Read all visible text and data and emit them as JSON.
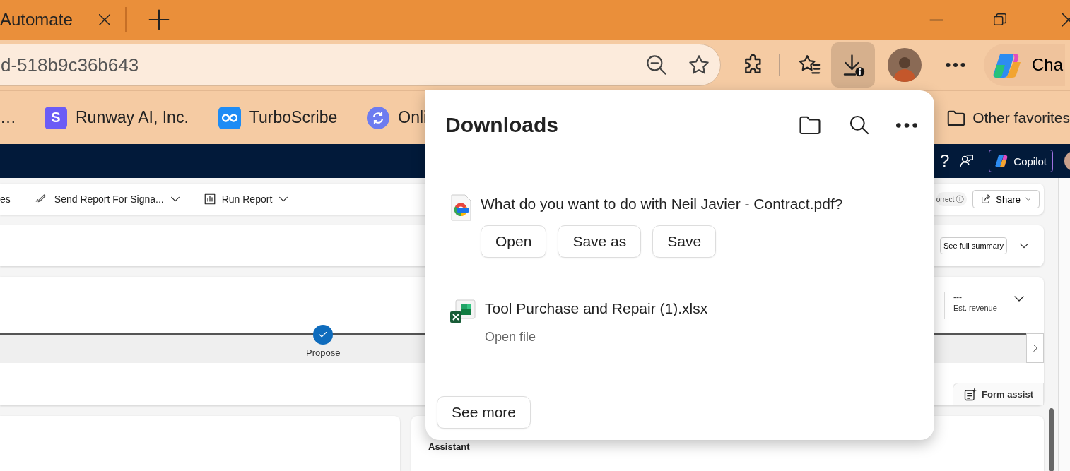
{
  "tab": {
    "title": "Automate"
  },
  "address_bar": {
    "url": "d-518b9c36b643"
  },
  "copilot_button": {
    "label": "Cha"
  },
  "favorites": [
    {
      "label": "…"
    },
    {
      "label": "Runway AI, Inc.",
      "icon_text": "S"
    },
    {
      "label": "TurboScribe"
    },
    {
      "label": "Onli"
    }
  ],
  "other_favorites": {
    "label": "Other favorites"
  },
  "nav_bar": {
    "help": "?",
    "copilot": "Copilot"
  },
  "commands": [
    {
      "label": "es"
    },
    {
      "label": "Send Report For Signa..."
    },
    {
      "label": "Run Report"
    }
  ],
  "notice": {
    "text": "orrect"
  },
  "share_button": {
    "label": "Share"
  },
  "summary_button": {
    "label": "See full summary"
  },
  "header_field": {
    "value": "---",
    "label": "Est. revenue"
  },
  "stage": {
    "label": "Propose",
    "completed": true
  },
  "form_assist": {
    "label": "Form assist"
  },
  "assistant_card": {
    "title": "Assistant"
  },
  "downloads": {
    "title": "Downloads",
    "items": [
      {
        "kind": "prompt",
        "text": "What do you want to do with Neil Javier - Contract.pdf?",
        "actions": [
          "Open",
          "Save as",
          "Save"
        ]
      },
      {
        "kind": "file",
        "name": "Tool Purchase and Repair (1).xlsx",
        "action": "Open file"
      }
    ],
    "see_more": "See more"
  }
}
